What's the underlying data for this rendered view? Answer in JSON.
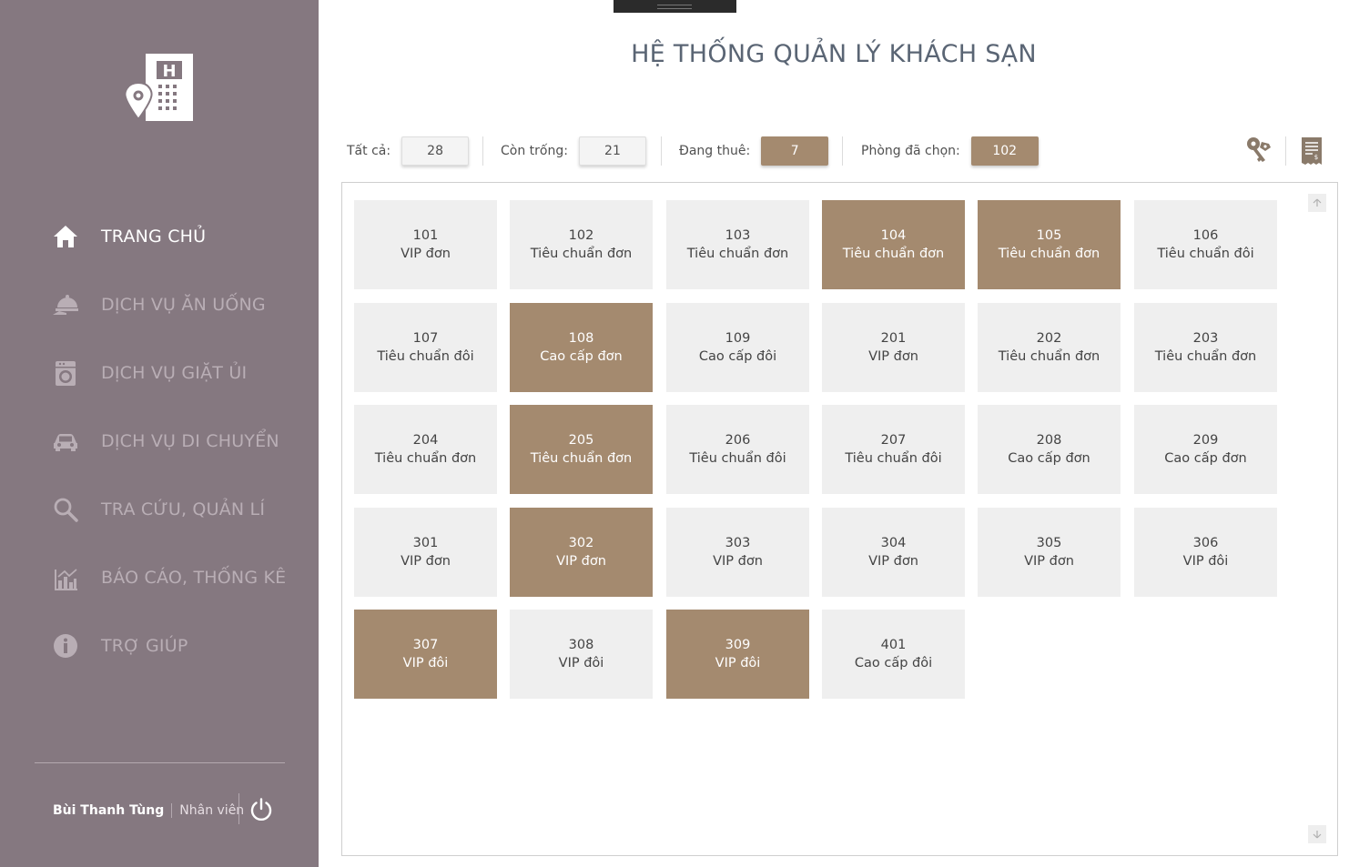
{
  "window": {
    "title": "HỆ THỐNG QUẢN LÝ KHÁCH SẠN"
  },
  "sidebar": {
    "items": [
      {
        "label": "TRANG CHỦ",
        "icon": "home-icon",
        "active": true
      },
      {
        "label": "DỊCH VỤ ĂN UỐNG",
        "icon": "room-service-icon",
        "active": false
      },
      {
        "label": "DỊCH VỤ GIẶT ỦI",
        "icon": "washing-machine-icon",
        "active": false
      },
      {
        "label": "DỊCH VỤ DI CHUYỂN",
        "icon": "car-icon",
        "active": false
      },
      {
        "label": "TRA CỨU, QUẢN LÍ",
        "icon": "search-icon",
        "active": false
      },
      {
        "label": "BÁO CÁO, THỐNG KÊ",
        "icon": "bar-chart-icon",
        "active": false
      },
      {
        "label": "TRỢ GIÚP",
        "icon": "info-icon",
        "active": false
      }
    ],
    "user": {
      "name": "Bùi Thanh Tùng",
      "role": "Nhân viên"
    }
  },
  "stats": {
    "total_label": "Tất cả:",
    "total": "28",
    "free_label": "Còn trống:",
    "free": "21",
    "rented_label": "Đang thuê:",
    "rented": "7",
    "selected_label": "Phòng đã chọn:",
    "selected": "102"
  },
  "toolbar": {
    "keys_icon": "keys-icon",
    "receipt_icon": "receipt-icon"
  },
  "colors": {
    "sidebar": "#857880",
    "occupied": "#a48a6f",
    "empty": "#efefef"
  },
  "rooms": [
    {
      "number": "101",
      "type": "VIP đơn",
      "status": "empty"
    },
    {
      "number": "102",
      "type": "Tiêu chuẩn đơn",
      "status": "empty"
    },
    {
      "number": "103",
      "type": "Tiêu chuẩn đơn",
      "status": "empty"
    },
    {
      "number": "104",
      "type": "Tiêu chuẩn đơn",
      "status": "occupied"
    },
    {
      "number": "105",
      "type": "Tiêu chuẩn đơn",
      "status": "occupied"
    },
    {
      "number": "106",
      "type": "Tiêu chuẩn đôi",
      "status": "empty"
    },
    {
      "number": "107",
      "type": "Tiêu chuẩn đôi",
      "status": "empty"
    },
    {
      "number": "108",
      "type": "Cao cấp đơn",
      "status": "occupied"
    },
    {
      "number": "109",
      "type": "Cao cấp đôi",
      "status": "empty"
    },
    {
      "number": "201",
      "type": "VIP đơn",
      "status": "empty"
    },
    {
      "number": "202",
      "type": "Tiêu chuẩn đơn",
      "status": "empty"
    },
    {
      "number": "203",
      "type": "Tiêu chuẩn đơn",
      "status": "empty"
    },
    {
      "number": "204",
      "type": "Tiêu chuẩn đơn",
      "status": "empty"
    },
    {
      "number": "205",
      "type": "Tiêu chuẩn đơn",
      "status": "occupied"
    },
    {
      "number": "206",
      "type": "Tiêu chuẩn đôi",
      "status": "empty"
    },
    {
      "number": "207",
      "type": "Tiêu chuẩn đôi",
      "status": "empty"
    },
    {
      "number": "208",
      "type": "Cao cấp đơn",
      "status": "empty"
    },
    {
      "number": "209",
      "type": "Cao cấp đơn",
      "status": "empty"
    },
    {
      "number": "301",
      "type": "VIP đơn",
      "status": "empty"
    },
    {
      "number": "302",
      "type": "VIP đơn",
      "status": "occupied"
    },
    {
      "number": "303",
      "type": "VIP đơn",
      "status": "empty"
    },
    {
      "number": "304",
      "type": "VIP đơn",
      "status": "empty"
    },
    {
      "number": "305",
      "type": "VIP đơn",
      "status": "empty"
    },
    {
      "number": "306",
      "type": "VIP đôi",
      "status": "empty"
    },
    {
      "number": "307",
      "type": "VIP đôi",
      "status": "occupied"
    },
    {
      "number": "308",
      "type": "VIP đôi",
      "status": "empty"
    },
    {
      "number": "309",
      "type": "VIP đôi",
      "status": "occupied"
    },
    {
      "number": "401",
      "type": "Cao cấp đôi",
      "status": "empty"
    }
  ]
}
